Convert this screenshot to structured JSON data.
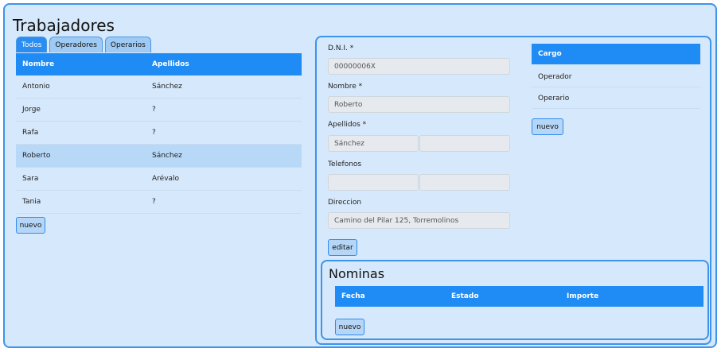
{
  "page": {
    "title": "Trabajadores"
  },
  "tabs": [
    {
      "label": "Todos",
      "active": true
    },
    {
      "label": "Operadores",
      "active": false
    },
    {
      "label": "Operarios",
      "active": false
    }
  ],
  "workers_table": {
    "headers": [
      "Nombre",
      "Apellidos"
    ],
    "rows": [
      {
        "nombre": "Antonio",
        "apellidos": "Sánchez"
      },
      {
        "nombre": "Jorge",
        "apellidos": "?"
      },
      {
        "nombre": "Rafa",
        "apellidos": "?"
      },
      {
        "nombre": "Roberto",
        "apellidos": "Sánchez",
        "selected": true
      },
      {
        "nombre": "Sara",
        "apellidos": "Arévalo"
      },
      {
        "nombre": "Tania",
        "apellidos": "?"
      }
    ],
    "new_button": "nuevo"
  },
  "detail": {
    "dni_label": "D.N.I. *",
    "dni_value": "00000006X",
    "nombre_label": "Nombre *",
    "nombre_value": "Roberto",
    "apellidos_label": "Apellidos *",
    "apellido1_value": "Sánchez",
    "apellido2_value": "",
    "telefonos_label": "Telefonos",
    "telefono1_value": "",
    "telefono2_value": "",
    "direccion_label": "Direccion",
    "direccion_value": "Camino del Pilar 125, Torremolinos",
    "edit_button": "editar"
  },
  "cargo": {
    "header": "Cargo",
    "items": [
      "Operador",
      "Operario"
    ],
    "new_button": "nuevo"
  },
  "nominas": {
    "title": "Nominas",
    "headers": [
      "Fecha",
      "Estado",
      "Importe"
    ],
    "new_button": "nuevo"
  }
}
